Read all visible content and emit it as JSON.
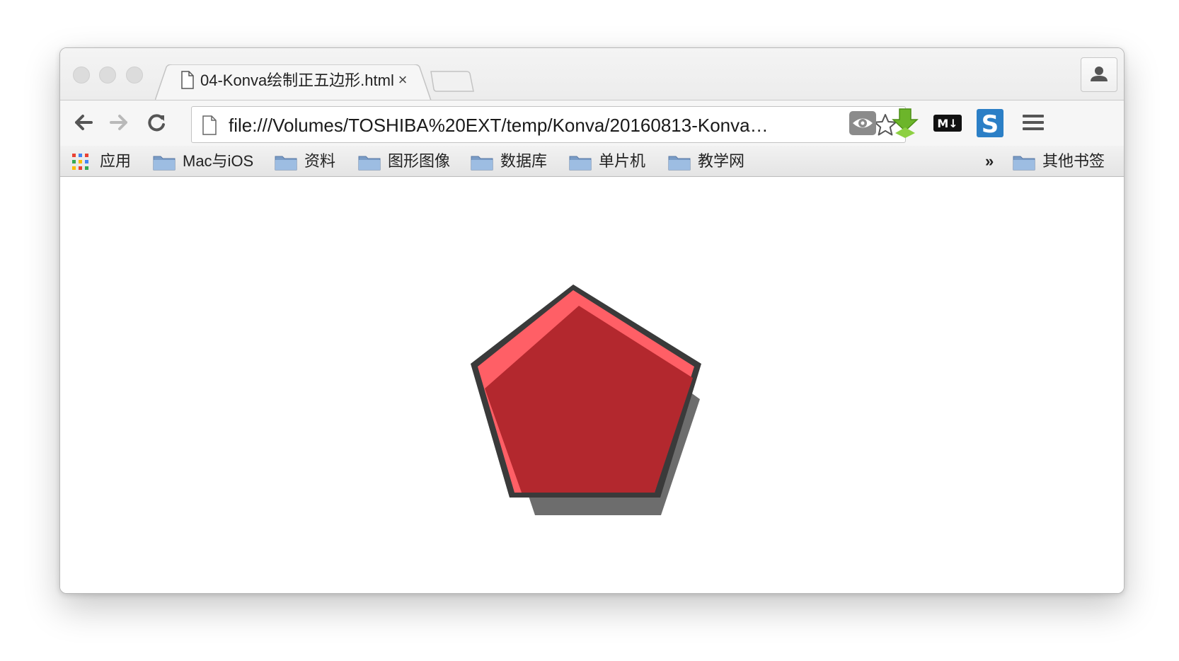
{
  "tab": {
    "title": "04-Konva绘制正五边形.html",
    "close_glyph": "×",
    "icon": "document-icon"
  },
  "toolbar": {
    "url": "file:///Volumes/TOSHIBA%20EXT/temp/Konva/20160813-Konva…",
    "back_icon": "back-arrow-icon",
    "forward_icon": "forward-arrow-icon",
    "reload_icon": "reload-icon",
    "star_icon": "bookmark-star-icon",
    "extensions": [
      {
        "name": "eye-extension-icon"
      },
      {
        "name": "download-extension-icon"
      },
      {
        "name": "markdown-extension-icon",
        "text": "M↓"
      },
      {
        "name": "s-extension-icon",
        "text": "S"
      }
    ],
    "menu_icon": "hamburger-menu-icon"
  },
  "bookmarks": {
    "apps_label": "应用",
    "items": [
      {
        "label": "Mac与iOS"
      },
      {
        "label": "资料"
      },
      {
        "label": "图形图像"
      },
      {
        "label": "数据库"
      },
      {
        "label": "单片机"
      },
      {
        "label": "教学网"
      }
    ],
    "overflow": "»",
    "other_label": "其他书签"
  },
  "canvas": {
    "shape": "regular-pentagon",
    "fill": "#b3282e",
    "highlight": "#ff5f66",
    "stroke": "#3a3a3a",
    "shadow": "#6a6a6a"
  }
}
